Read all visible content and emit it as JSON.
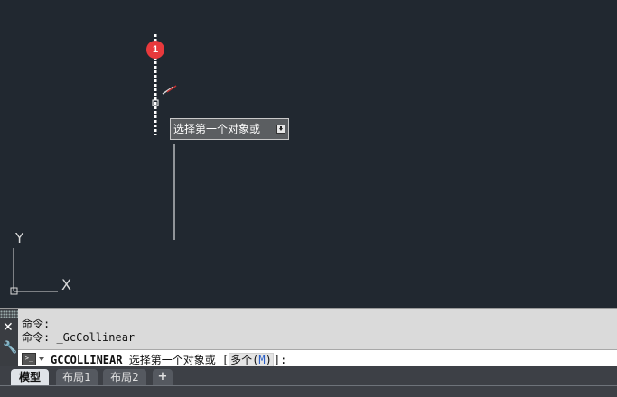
{
  "canvas": {
    "marker_number": "1",
    "tooltip_text": "选择第一个对象或",
    "ucs": {
      "y_label": "Y",
      "x_label": "X"
    }
  },
  "command_panel": {
    "history": [
      "命令:",
      "命令: _GcCollinear"
    ],
    "command_name": "GCCOLLINEAR",
    "prompt_text": " 选择第一个对象或 [",
    "option_label": "多个(",
    "option_key": "M",
    "option_close": ")",
    "prompt_end": "]:"
  },
  "tabs": [
    {
      "label": "模型",
      "active": true
    },
    {
      "label": "布局1",
      "active": false
    },
    {
      "label": "布局2",
      "active": false
    },
    {
      "label": "+",
      "active": false
    }
  ],
  "colors": {
    "canvas_bg": "#212830",
    "marker": "#e8393c",
    "annotation_arrow": "#e8393c"
  },
  "icons": [
    "close-icon",
    "wrench-icon",
    "command-prompt-icon",
    "dropdown-arrow-icon",
    "add-layout-icon"
  ]
}
